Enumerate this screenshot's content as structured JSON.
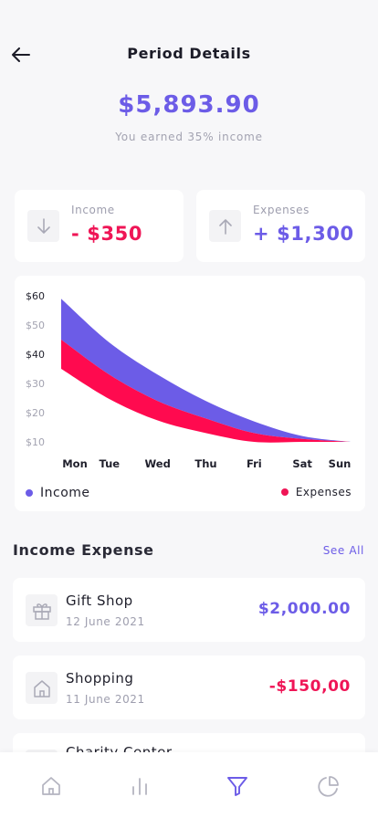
{
  "header": {
    "title": "Period Details",
    "back_icon": "arrow-left-icon"
  },
  "summary": {
    "amount": "$5,893.90",
    "subtitle": "You earned 35% income"
  },
  "stats": {
    "income": {
      "label": "Income",
      "value": "- $350",
      "icon": "arrow-down-icon",
      "color": "#ef1556"
    },
    "expenses": {
      "label": "Expenses",
      "value": "+ $1,300",
      "icon": "arrow-up-icon",
      "color": "#6c5ce7"
    }
  },
  "chart_data": {
    "type": "area",
    "categories": [
      "Mon",
      "Tue",
      "Wed",
      "Thu",
      "Fri",
      "Sat",
      "Sun"
    ],
    "y_ticks": [
      "$60",
      "$50",
      "$40",
      "$30",
      "$20",
      "$10"
    ],
    "ylim": [
      10,
      60
    ],
    "series": [
      {
        "name": "Income",
        "color": "#6c5ce7",
        "values": [
          59,
          44,
          33,
          24,
          17,
          12,
          10
        ]
      },
      {
        "name": "Expenses",
        "color": "#ff0a4f",
        "values": [
          45,
          33,
          24,
          18,
          13,
          11,
          10
        ]
      }
    ],
    "legend": "bottom"
  },
  "legend": {
    "income": "Income",
    "expenses": "Expenses"
  },
  "section": {
    "title": "Income Expense",
    "see_all": "See All"
  },
  "transactions": [
    {
      "title": "Gift Shop",
      "date": "12 June 2021",
      "amount": "$2,000.00",
      "icon": "gift-icon",
      "color": "#6c5ce7"
    },
    {
      "title": "Shopping",
      "date": "11 June 2021",
      "amount": "-$150,00",
      "icon": "home-icon",
      "color": "#ef1556"
    },
    {
      "title": "Charity Center",
      "icon": "heart-icon"
    }
  ],
  "nav": [
    "home-icon",
    "bar-chart-icon",
    "filter-icon",
    "pie-chart-icon"
  ],
  "colors": {
    "accent": "#6c5ce7",
    "negative": "#ef1556",
    "background": "#f7f7f9"
  }
}
